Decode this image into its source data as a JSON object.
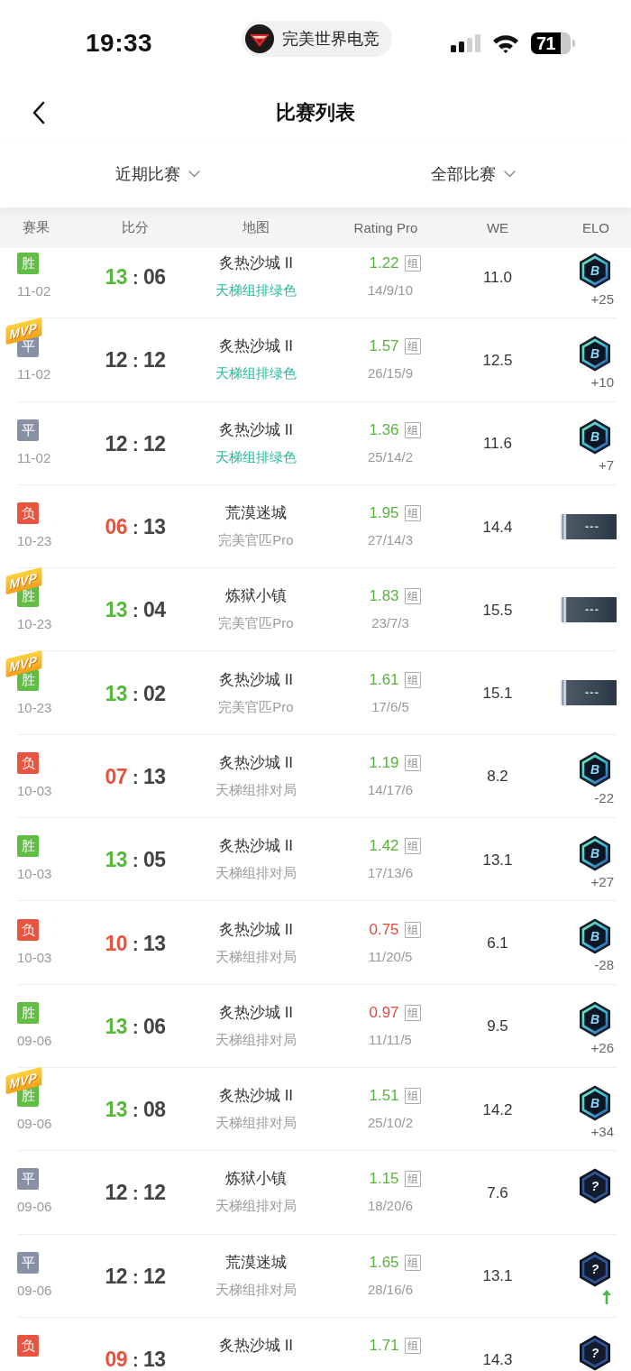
{
  "status_bar": {
    "time": "19:33",
    "app_pill": "完美世界电竞",
    "battery": "71"
  },
  "nav": {
    "title": "比赛列表"
  },
  "filters": [
    {
      "label": "近期比赛"
    },
    {
      "label": "全部比赛"
    }
  ],
  "table": {
    "columns": [
      "赛果",
      "比分",
      "地图",
      "Rating Pro",
      "WE",
      "ELO"
    ],
    "rows": [
      {
        "kind": "win",
        "result": "胜",
        "date": "11-02",
        "score": {
          "own": "13",
          "sep": ":",
          "opp": "06"
        },
        "map": "炙热沙城 II",
        "mode": "天梯组排绿色",
        "mode_highlighted": true,
        "rating": "1.22",
        "rating_low": false,
        "tag": "组",
        "kda": "14/9/10",
        "we": "11.0",
        "elo": {
          "kind": "ranked",
          "rank": "B",
          "delta": "+25"
        }
      },
      {
        "kind": "draw",
        "result": "平",
        "mvp": "MVP",
        "date": "11-02",
        "score": {
          "own": "12",
          "sep": ":",
          "opp": "12"
        },
        "map": "炙热沙城 II",
        "mode": "天梯组排绿色",
        "mode_highlighted": true,
        "rating": "1.57",
        "rating_low": false,
        "tag": "组",
        "kda": "26/15/9",
        "we": "12.5",
        "elo": {
          "kind": "ranked",
          "rank": "B",
          "delta": "+10"
        }
      },
      {
        "kind": "draw",
        "result": "平",
        "date": "11-02",
        "score": {
          "own": "12",
          "sep": ":",
          "opp": "12"
        },
        "map": "炙热沙城 II",
        "mode": "天梯组排绿色",
        "mode_highlighted": true,
        "rating": "1.36",
        "rating_low": false,
        "tag": "组",
        "kda": "25/14/2",
        "we": "11.6",
        "elo": {
          "kind": "ranked",
          "rank": "B",
          "delta": "+7"
        }
      },
      {
        "kind": "loss",
        "result": "负",
        "date": "10-23",
        "score": {
          "own": "06",
          "sep": ":",
          "opp": "13"
        },
        "map": "荒漠迷城",
        "mode": "完美官匹Pro",
        "mode_highlighted": false,
        "rating": "1.95",
        "rating_low": false,
        "tag": "组",
        "kda": "27/14/3",
        "we": "14.4",
        "elo": {
          "kind": "placeholder",
          "label": "---"
        }
      },
      {
        "kind": "win",
        "result": "胜",
        "mvp": "MVP",
        "date": "10-23",
        "score": {
          "own": "13",
          "sep": ":",
          "opp": "04"
        },
        "map": "炼狱小镇",
        "mode": "完美官匹Pro",
        "mode_highlighted": false,
        "rating": "1.83",
        "rating_low": false,
        "tag": "组",
        "kda": "23/7/3",
        "we": "15.5",
        "elo": {
          "kind": "placeholder",
          "label": "---"
        }
      },
      {
        "kind": "win",
        "result": "胜",
        "mvp": "MVP",
        "date": "10-23",
        "score": {
          "own": "13",
          "sep": ":",
          "opp": "02"
        },
        "map": "炙热沙城 II",
        "mode": "完美官匹Pro",
        "mode_highlighted": false,
        "rating": "1.61",
        "rating_low": false,
        "tag": "组",
        "kda": "17/6/5",
        "we": "15.1",
        "elo": {
          "kind": "placeholder",
          "label": "---"
        }
      },
      {
        "kind": "loss",
        "result": "负",
        "date": "10-03",
        "score": {
          "own": "07",
          "sep": ":",
          "opp": "13"
        },
        "map": "炙热沙城 II",
        "mode": "天梯组排对局",
        "mode_highlighted": false,
        "rating": "1.19",
        "rating_low": false,
        "tag": "组",
        "kda": "14/17/6",
        "we": "8.2",
        "elo": {
          "kind": "ranked",
          "rank": "B",
          "delta": "-22"
        }
      },
      {
        "kind": "win",
        "result": "胜",
        "date": "10-03",
        "score": {
          "own": "13",
          "sep": ":",
          "opp": "05"
        },
        "map": "炙热沙城 II",
        "mode": "天梯组排对局",
        "mode_highlighted": false,
        "rating": "1.42",
        "rating_low": false,
        "tag": "组",
        "kda": "17/13/6",
        "we": "13.1",
        "elo": {
          "kind": "ranked",
          "rank": "B",
          "delta": "+27"
        }
      },
      {
        "kind": "loss",
        "result": "负",
        "date": "10-03",
        "score": {
          "own": "10",
          "sep": ":",
          "opp": "13"
        },
        "map": "炙热沙城 II",
        "mode": "天梯组排对局",
        "mode_highlighted": false,
        "rating": "0.75",
        "rating_low": true,
        "tag": "组",
        "kda": "11/20/5",
        "we": "6.1",
        "elo": {
          "kind": "ranked",
          "rank": "B",
          "delta": "-28"
        }
      },
      {
        "kind": "win",
        "result": "胜",
        "date": "09-06",
        "score": {
          "own": "13",
          "sep": ":",
          "opp": "06"
        },
        "map": "炙热沙城 II",
        "mode": "天梯组排对局",
        "mode_highlighted": false,
        "rating": "0.97",
        "rating_low": true,
        "tag": "组",
        "kda": "11/11/5",
        "we": "9.5",
        "elo": {
          "kind": "ranked",
          "rank": "B",
          "delta": "+26"
        }
      },
      {
        "kind": "win",
        "result": "胜",
        "mvp": "MVP",
        "date": "09-06",
        "score": {
          "own": "13",
          "sep": ":",
          "opp": "08"
        },
        "map": "炙热沙城 II",
        "mode": "天梯组排对局",
        "mode_highlighted": false,
        "rating": "1.51",
        "rating_low": false,
        "tag": "组",
        "kda": "25/10/2",
        "we": "14.2",
        "elo": {
          "kind": "ranked",
          "rank": "B",
          "delta": "+34"
        }
      },
      {
        "kind": "draw",
        "result": "平",
        "date": "09-06",
        "score": {
          "own": "12",
          "sep": ":",
          "opp": "12"
        },
        "map": "炼狱小镇",
        "mode": "天梯组排对局",
        "mode_highlighted": false,
        "rating": "1.15",
        "rating_low": false,
        "tag": "组",
        "kda": "18/20/6",
        "we": "7.6",
        "elo": {
          "kind": "unranked",
          "rank": "?",
          "rising": false
        }
      },
      {
        "kind": "draw",
        "result": "平",
        "date": "09-06",
        "score": {
          "own": "12",
          "sep": ":",
          "opp": "12"
        },
        "map": "荒漠迷城",
        "mode": "天梯组排对局",
        "mode_highlighted": false,
        "rating": "1.65",
        "rating_low": false,
        "tag": "组",
        "kda": "28/16/6",
        "we": "13.1",
        "elo": {
          "kind": "unranked",
          "rank": "?",
          "rising": true
        }
      },
      {
        "kind": "loss",
        "result": "负",
        "score": {
          "own": "09",
          "sep": ":",
          "opp": "13"
        },
        "map": "炙热沙城 II",
        "rating": "1.71",
        "rating_low": false,
        "tag": "组",
        "we": "14.3",
        "elo": {
          "kind": "unranked",
          "rank": "?"
        }
      }
    ]
  }
}
